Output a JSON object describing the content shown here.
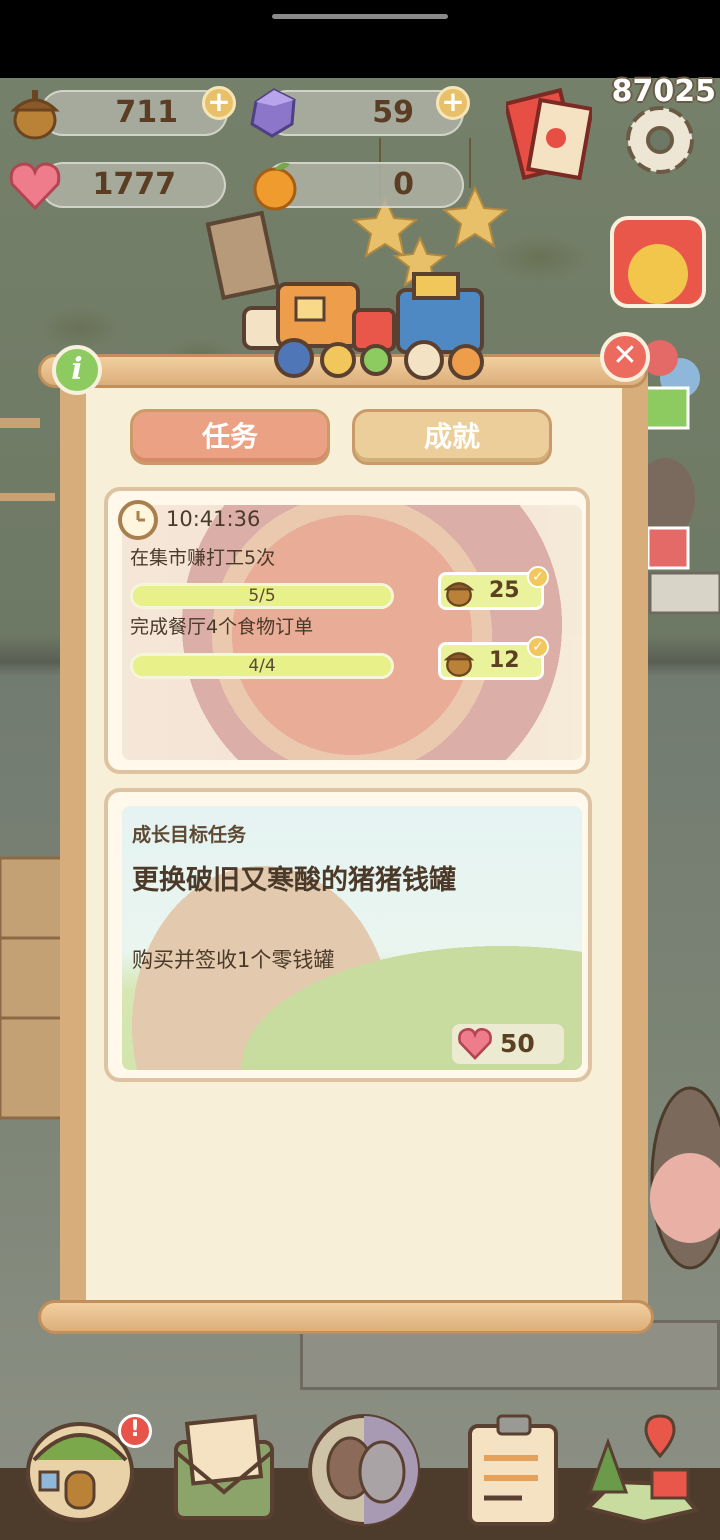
{
  "resources": {
    "acorns": "711",
    "gems": "59",
    "hearts": "1777",
    "oranges": "0"
  },
  "score": "87025",
  "plus_symbol": "+",
  "info_symbol": "i",
  "close_symbol": "✕",
  "tabs": {
    "tasks": "任务",
    "achievements": "成就",
    "active": "tasks"
  },
  "daily": {
    "timer": "10:41:36",
    "tasks": [
      {
        "text": "在集市赚打工5次",
        "progress": "5/5",
        "fraction": 1.0,
        "reward": "25",
        "reward_icon": "acorn-icon",
        "claimed": true
      },
      {
        "text": "完成餐厅4个食物订单",
        "progress": "4/4",
        "fraction": 1.0,
        "reward": "12",
        "reward_icon": "acorn-icon",
        "claimed": true
      }
    ]
  },
  "growth": {
    "tag": "成长目标任务",
    "title": "更换破旧又寒酸的猪猪钱罐",
    "desc": "购买并签收1个零钱罐",
    "reward": "50",
    "reward_icon": "heart-gem-icon"
  },
  "nav": {
    "home_alert": "!"
  },
  "colors": {
    "tab_active": "#eba183",
    "tab_inactive": "#ecce9b",
    "panel": "#f7eed8",
    "frame": "#d7ad7c",
    "progress": "#dfe68b",
    "close": "#ec6a5e",
    "info": "#8dcb61"
  }
}
